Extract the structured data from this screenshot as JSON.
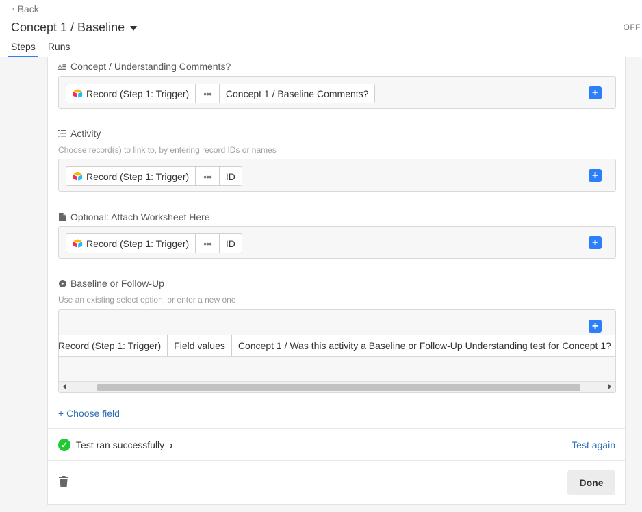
{
  "header": {
    "back_label": "Back",
    "title": "Concept 1 / Baseline",
    "status": "OFF",
    "tabs": [
      {
        "label": "Steps",
        "active": true
      },
      {
        "label": "Runs",
        "active": false
      }
    ]
  },
  "fields": [
    {
      "label": "Concept / Understanding Comments?",
      "icon": "long-text-icon",
      "hint": "",
      "tokens": [
        "Record (Step 1: Trigger)",
        "•••",
        "Concept 1 / Baseline Comments?"
      ]
    },
    {
      "label": "Activity",
      "icon": "linked-record-icon",
      "hint": "Choose record(s) to link to, by entering record IDs or names",
      "tokens": [
        "Record (Step 1: Trigger)",
        "•••",
        "ID"
      ]
    },
    {
      "label": "Optional: Attach Worksheet Here",
      "icon": "attachment-icon",
      "hint": "",
      "tokens": [
        "Record (Step 1: Trigger)",
        "•••",
        "ID"
      ]
    },
    {
      "label": "Baseline or Follow-Up",
      "icon": "single-select-icon",
      "hint": "Use an existing select option, or enter a new one",
      "tokens": [
        "Record (Step 1: Trigger)",
        "Field values",
        "Concept 1 / Was this activity a Baseline or Follow-Up Understanding test for Concept 1?"
      ]
    }
  ],
  "choose_field_label": "+ Choose field",
  "test": {
    "status": "Test ran successfully",
    "again_label": "Test again"
  },
  "done_label": "Done",
  "colors": {
    "accent": "#2d7ff9",
    "link": "#2d6fb7",
    "success": "#20c933"
  }
}
